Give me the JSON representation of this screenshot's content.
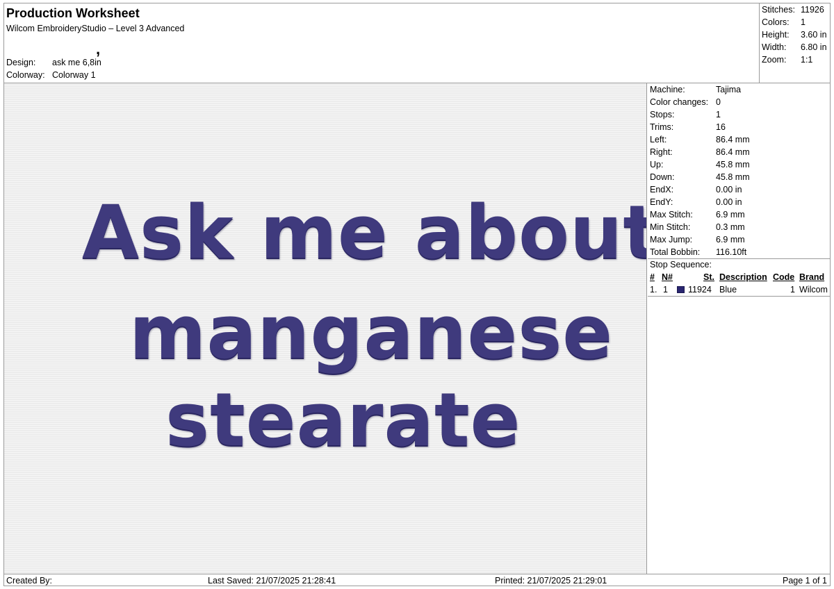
{
  "header": {
    "title": "Production Worksheet",
    "subtitle": "Wilcom EmbroideryStudio – Level 3 Advanced",
    "comma": ",",
    "design_label": "Design:",
    "design_value": "ask me 6,8in",
    "colorway_label": "Colorway:",
    "colorway_value": "Colorway 1"
  },
  "summary": [
    {
      "label": "Stitches:",
      "value": "11926"
    },
    {
      "label": "Colors:",
      "value": "1"
    },
    {
      "label": "Height:",
      "value": "3.60 in"
    },
    {
      "label": "Width:",
      "value": "6.80 in"
    },
    {
      "label": "Zoom:",
      "value": "1:1"
    }
  ],
  "design_text": {
    "line1": "Ask me about",
    "line2": "manganese",
    "line3": "stearate",
    "thread_color": "#3f3a7d"
  },
  "machine_info": [
    {
      "label": "Machine:",
      "value": "Tajima"
    },
    {
      "label": "Color changes:",
      "value": "0"
    },
    {
      "label": "Stops:",
      "value": "1"
    },
    {
      "label": "Trims:",
      "value": "16"
    },
    {
      "label": "Left:",
      "value": "86.4 mm"
    },
    {
      "label": "Right:",
      "value": "86.4 mm"
    },
    {
      "label": "Up:",
      "value": "45.8 mm"
    },
    {
      "label": "Down:",
      "value": "45.8 mm"
    },
    {
      "label": "EndX:",
      "value": "0.00 in"
    },
    {
      "label": "EndY:",
      "value": "0.00 in"
    },
    {
      "label": "Max Stitch:",
      "value": "6.9 mm"
    },
    {
      "label": "Min Stitch:",
      "value": "0.3 mm"
    },
    {
      "label": "Max Jump:",
      "value": "6.9 mm"
    },
    {
      "label": "Total Bobbin:",
      "value": "116.10ft"
    }
  ],
  "stop_sequence": {
    "title": "Stop Sequence:",
    "headers": {
      "index": "#",
      "needle": "N#",
      "stitches": "St.",
      "description": "Description",
      "code": "Code",
      "brand": "Brand"
    },
    "rows": [
      {
        "index": "1.",
        "needle": "1",
        "swatch_color": "#2a2670",
        "stitches": "11924",
        "description": "Blue",
        "code": "1",
        "brand": "Wilcom"
      }
    ]
  },
  "footer": {
    "created_by": "Created By:",
    "last_saved": "Last Saved: 21/07/2025 21:28:41",
    "printed": "Printed: 21/07/2025 21:29:01",
    "page": "Page 1 of 1"
  }
}
